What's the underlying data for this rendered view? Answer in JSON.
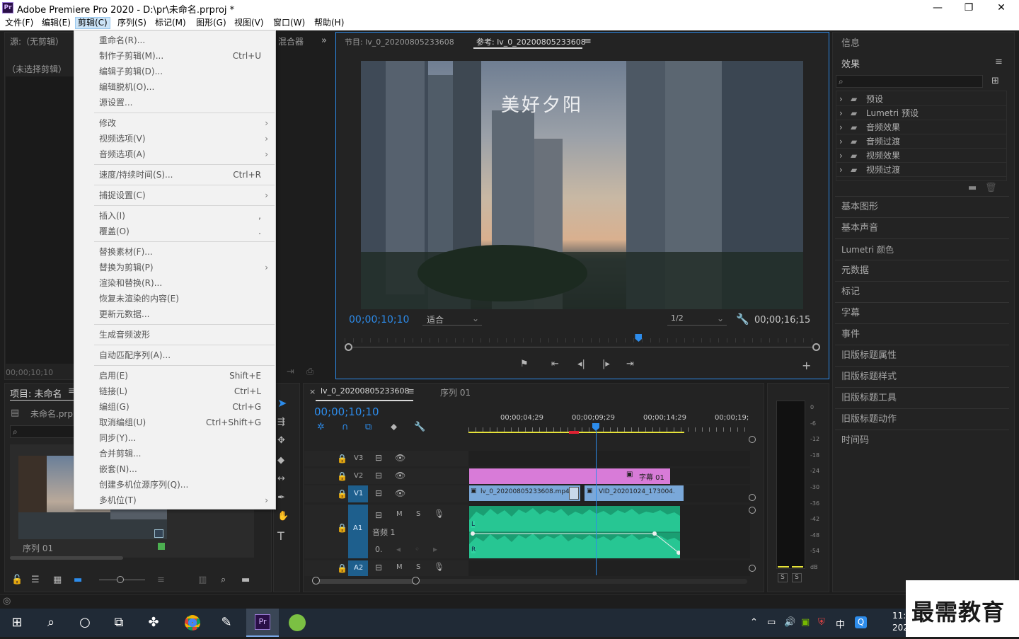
{
  "window": {
    "title": "Adobe Premiere Pro 2020 - D:\\pr\\未命名.prproj *",
    "logo": "Pr",
    "min": "—",
    "max": "❐",
    "close": "✕"
  },
  "menubar": [
    "文件(F)",
    "编辑(E)",
    "剪辑(C)",
    "序列(S)",
    "标记(M)",
    "图形(G)",
    "视图(V)",
    "窗口(W)",
    "帮助(H)"
  ],
  "clip_menu": {
    "items": [
      {
        "label": "重命名(R)...",
        "shortcut": ""
      },
      {
        "label": "制作子剪辑(M)...",
        "shortcut": "Ctrl+U"
      },
      {
        "label": "编辑子剪辑(D)...",
        "shortcut": ""
      },
      {
        "label": "编辑脱机(O)...",
        "shortcut": ""
      },
      {
        "label": "源设置...",
        "shortcut": ""
      },
      {
        "label": "修改",
        "shortcut": "",
        "sub": true
      },
      {
        "label": "视频选项(V)",
        "shortcut": "",
        "sub": true
      },
      {
        "label": "音频选项(A)",
        "shortcut": "",
        "sub": true
      },
      {
        "label": "速度/持续时间(S)...",
        "shortcut": "Ctrl+R"
      },
      {
        "label": "捕捉设置(C)",
        "shortcut": "",
        "sub": true
      },
      {
        "label": "插入(I)",
        "shortcut": ","
      },
      {
        "label": "覆盖(O)",
        "shortcut": "."
      },
      {
        "label": "替换素材(F)...",
        "shortcut": ""
      },
      {
        "label": "替换为剪辑(P)",
        "shortcut": "",
        "sub": true
      },
      {
        "label": "渲染和替换(R)...",
        "shortcut": ""
      },
      {
        "label": "恢复未渲染的内容(E)",
        "shortcut": ""
      },
      {
        "label": "更新元数据...",
        "shortcut": ""
      },
      {
        "label": "生成音频波形",
        "shortcut": ""
      },
      {
        "label": "自动匹配序列(A)...",
        "shortcut": ""
      },
      {
        "label": "启用(E)",
        "shortcut": "Shift+E"
      },
      {
        "label": "链接(L)",
        "shortcut": "Ctrl+L"
      },
      {
        "label": "编组(G)",
        "shortcut": "Ctrl+G"
      },
      {
        "label": "取消编组(U)",
        "shortcut": "Ctrl+Shift+G"
      },
      {
        "label": "同步(Y)...",
        "shortcut": ""
      },
      {
        "label": "合并剪辑...",
        "shortcut": ""
      },
      {
        "label": "嵌套(N)...",
        "shortcut": ""
      },
      {
        "label": "创建多机位源序列(Q)...",
        "shortcut": ""
      },
      {
        "label": "多机位(T)",
        "shortcut": "",
        "sub": true
      }
    ]
  },
  "source_panel": {
    "title": "源:（无剪辑）",
    "empty": "（未选择剪辑）",
    "timecode": "00;00;10;10",
    "mixer_tab": "混合器"
  },
  "program_monitor": {
    "tab1": "节目: lv_0_20200805233608",
    "tab2": "参考: lv_0_20200805233608",
    "video_overlay": "美好夕阳",
    "timecode": "00;00;10;10",
    "fit": "适合",
    "resolution": "1/2",
    "duration": "00;00;16;15",
    "playhead_fraction": 0.62
  },
  "right_panel": {
    "info": "信息",
    "effects": "效果",
    "effects_items": [
      "预设",
      "Lumetri 预设",
      "音频效果",
      "音频过渡",
      "视频效果",
      "视频过渡"
    ],
    "panels": [
      "基本图形",
      "基本声音",
      "Lumetri 颜色",
      "元数据",
      "标记",
      "字幕",
      "事件",
      "旧版标题属性",
      "旧版标题样式",
      "旧版标题工具",
      "旧版标题动作",
      "时间码"
    ]
  },
  "project_panel": {
    "title": "项目: 未命名",
    "file": "未命名.prpr",
    "thumb_label": "序列 01"
  },
  "timeline": {
    "tab": "lv_0_20200805233608",
    "tab2": "序列 01",
    "timecode": "00;00;10;10",
    "ruler": [
      "00;00;04;29",
      "00;00;09;29",
      "00;00;14;29",
      "00;00;19;"
    ],
    "tracks": {
      "v3": "V3",
      "v2": "V2",
      "v1": "V1",
      "a1": "A1",
      "a1_name": "音频 1",
      "a2": "A2"
    },
    "clips": {
      "title": "字幕 01",
      "video1": "lv_0_20200805233608.mp4",
      "video2": "VID_20201024_173004."
    },
    "toggles": {
      "m": "M",
      "s": "S"
    },
    "channel_l": "L",
    "channel_r": "R",
    "pan_value": "0."
  },
  "meter": {
    "scale": [
      "0",
      "-6",
      "-12",
      "-18",
      "-24",
      "-30",
      "-36",
      "-42",
      "-48",
      "-54",
      "dB"
    ],
    "solo": "S"
  },
  "taskbar": {
    "clock": "11:",
    "date": "202",
    "ime": "中",
    "watermark": "最需教育"
  },
  "colors": {
    "accent": "#2d8ceb",
    "title_clip": "#d87bd8",
    "video_clip": "#7aa8d9",
    "audio_clip": "#27c693"
  }
}
